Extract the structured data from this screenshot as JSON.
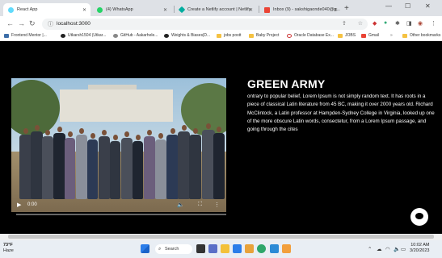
{
  "browser": {
    "tabs": [
      {
        "label": "React App",
        "active": true,
        "color": "#61dafb"
      },
      {
        "label": "(4) WhatsApp",
        "active": false,
        "color": "#25d366"
      },
      {
        "label": "Create a Netlify account | Netlify",
        "active": false,
        "color": "#00ad9f"
      },
      {
        "label": "Inbox (9) - sakshigaonde040@g...",
        "active": false,
        "color": "#ea4335"
      }
    ],
    "new_tab": "+",
    "window_controls": {
      "minimize": "—",
      "maximize": "☐",
      "close": "✕"
    },
    "url": "localhost:3000",
    "bookmarks": [
      "Frontend Mentor |...",
      "Utkarsh1504 (Utkar...",
      "GitHub - Aakarhele...",
      "Weights & Biases|D...",
      "jobs postt",
      "Baby Project",
      "Oracle Database Ex...",
      "JOBS",
      "Gmail",
      "Other bookmarks"
    ]
  },
  "page": {
    "heading": "GREEN ARMY",
    "body": "ontrary to popular belief, Lorem Ipsum is not simply random text. It has roots in a piece of classical Latin literature from 45 BC, making it over 2000 years old. Richard McClintock, a Latin professor at Hampden-Sydney College in Virginia, looked up one of the more obscure Latin words, consectetur, from a Lorem Ipsum passage, and going through the cites",
    "video": {
      "time": "0:00",
      "progress": 0.0,
      "play_icon": "play-icon",
      "volume_icon": "volume-icon",
      "fullscreen_icon": "fullscreen-icon",
      "more_icon": "more-icon"
    },
    "chat_icon": "chat-icon"
  },
  "taskbar": {
    "weather_temp": "73°F",
    "weather_desc": "Haze",
    "search_label": "Search",
    "time": "10:02 AM",
    "date": "3/20/2023"
  }
}
